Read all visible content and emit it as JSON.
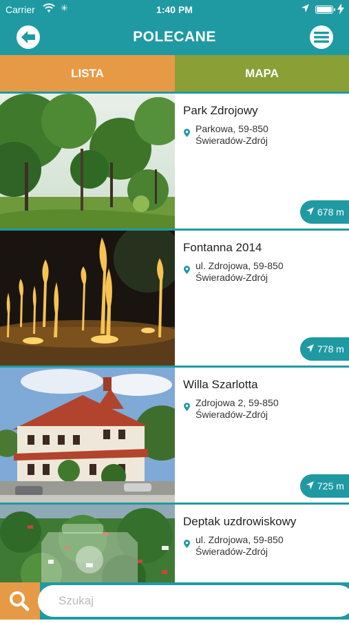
{
  "status": {
    "carrier": "Carrier",
    "time": "1:40 PM"
  },
  "header": {
    "title": "POLECANE"
  },
  "tabs": [
    {
      "label": "LISTA"
    },
    {
      "label": "MAPA"
    }
  ],
  "items": [
    {
      "name": "Park Zdrojowy",
      "address_line1": "Parkowa, 59-850",
      "address_line2": "Świeradów-Zdrój",
      "distance": "678 m"
    },
    {
      "name": "Fontanna 2014",
      "address_line1": "ul. Zdrojowa, 59-850",
      "address_line2": "Świeradów-Zdrój",
      "distance": "778 m"
    },
    {
      "name": "Willa Szarlotta",
      "address_line1": "Zdrojowa 2, 59-850",
      "address_line2": "Świeradów-Zdrój",
      "distance": "725 m"
    },
    {
      "name": "Deptak uzdrowiskowy",
      "address_line1": "ul. Zdrojowa, 59-850",
      "address_line2": "Świeradów-Zdrój",
      "distance": ""
    }
  ],
  "search": {
    "placeholder": "Szukaj"
  },
  "colors": {
    "primary": "#1f9aa3",
    "orange": "#e79a46",
    "olive": "#8a9f35"
  }
}
